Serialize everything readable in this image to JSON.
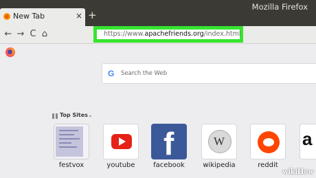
{
  "window": {
    "title": "Mozilla Firefox"
  },
  "tab": {
    "title": "New Tab",
    "close_glyph": "×",
    "new_tab_glyph": "+"
  },
  "nav": {
    "back_glyph": "←",
    "forward_glyph": "→",
    "reload_glyph": "C",
    "home_glyph": "⌂",
    "url_prefix": "https://www.",
    "url_domain": "apachefriends.org",
    "url_suffix": "/index.html"
  },
  "search": {
    "placeholder": "Search the Web",
    "engine_icon": "G"
  },
  "top_sites": {
    "heading": "Top Sites",
    "chevron": "⌄",
    "sites": [
      {
        "label": "festvox"
      },
      {
        "label": "youtube"
      },
      {
        "label": "facebook"
      },
      {
        "label": "wikipedia"
      },
      {
        "label": "reddit"
      }
    ]
  },
  "colors": {
    "url_highlight": "#35e52f",
    "titlebar": "#3b3a35",
    "youtube_red": "#e62117",
    "facebook_blue": "#3b5998",
    "reddit_orange": "#ff4500"
  },
  "watermark": "wikiHow"
}
